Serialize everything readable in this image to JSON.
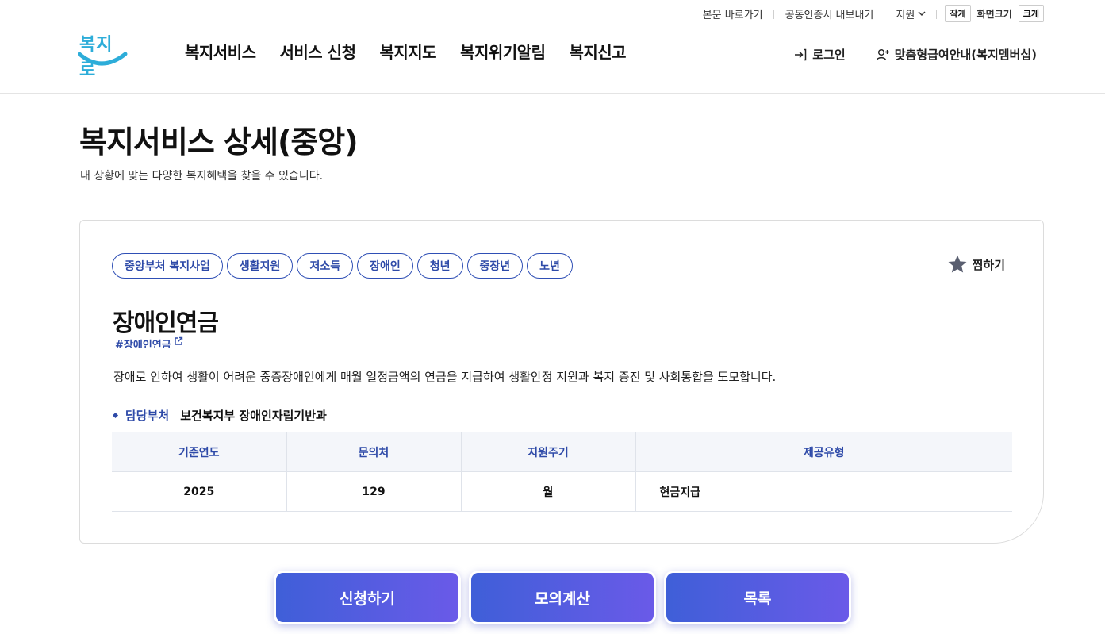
{
  "utility": {
    "skip_link": "본문 바로가기",
    "cert_export": "공동인증서 내보내기",
    "lang": "지원",
    "size_small": "작게",
    "size_label": "화면크기",
    "size_large": "크게"
  },
  "header": {
    "logo_text": "복지로",
    "nav": [
      "복지서비스",
      "서비스 신청",
      "복지지도",
      "복지위기알림",
      "복지신고"
    ],
    "login": "로그인",
    "membership": "맞춤형급여안내(복지멤버십)"
  },
  "page": {
    "title": "복지서비스 상세(중앙)",
    "subtitle": "내 상황에 맞는 다양한 복지혜택을 찾을 수 있습니다."
  },
  "service": {
    "tags": [
      "중앙부처 복지사업",
      "생활지원",
      "저소득",
      "장애인",
      "청년",
      "중장년",
      "노년"
    ],
    "favorite": "찜하기",
    "title": "장애인연금",
    "hashtag": "#장애인연금",
    "description": "장애로 인하여 생활이 어려운 중증장애인에게 매월 일정금액의 연금을 지급하여 생활안정 지원과 복지 증진 및 사회통합을 도모합니다.",
    "dept_label": "담당부처",
    "dept_value": "보건복지부 장애인자립기반과",
    "table": {
      "headers": [
        "기준연도",
        "문의처",
        "지원주기",
        "제공유형"
      ],
      "row": [
        "2025",
        "129",
        "월",
        "현금지급"
      ]
    }
  },
  "actions": {
    "apply": "신청하기",
    "simulate": "모의계산",
    "list": "목록"
  },
  "colors": {
    "accent": "#2e4aa8",
    "button_start": "#3f5fd8",
    "button_end": "#6a5ae8",
    "logo": "#2dadd9"
  }
}
